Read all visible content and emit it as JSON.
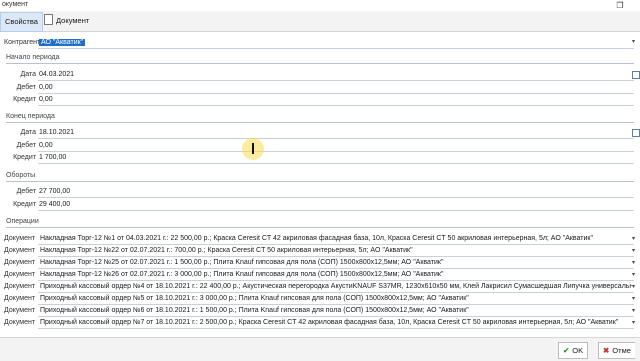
{
  "window": {
    "title": "окумент",
    "restore_glyph": "❐"
  },
  "tabs": [
    {
      "label": "Свойства"
    },
    {
      "label": "Документ"
    }
  ],
  "counterparty": {
    "label": "Контрагент",
    "value": "АО \"Акватик\""
  },
  "period_start": {
    "title": "Начало периода",
    "date_label": "Дата",
    "date": "04.03.2021",
    "debit_label": "Дебет",
    "debit": "0,00",
    "credit_label": "Кредит",
    "credit": "0,00"
  },
  "period_end": {
    "title": "Конец периода",
    "date_label": "Дата",
    "date": "18.10.2021",
    "debit_label": "Дебет",
    "debit": "0,00",
    "credit_label": "Кредит",
    "credit": "1 700,00"
  },
  "turnover": {
    "title": "Обороты",
    "debit_label": "Дебет",
    "debit": "27 700,00",
    "credit_label": "Кредит",
    "credit": "29 400,00"
  },
  "operations": {
    "title": "Операции",
    "row_label": "Документ",
    "rows": [
      "Накладная Торг-12 №1 от 04.03.2021 г.: 22 500,00 р.; Краска Ceresit CT 42 акриловая фасадная база, 10л, Краска Ceresit CT 50 акриловая интерьерная, 5л; АО \"Акватик\"",
      "Накладная Торг-12 №22 от 02.07.2021 г.: 700,00 р.; Краска Ceresit CT 50 акриловая интерьерная, 5л; АО \"Акватик\"",
      "Накладная Торг-12 №25 от 02.07.2021 г.: 1 500,00 р.; Плита Knauf гипсовая для пола (СОП) 1500х800х12,5мм; АО \"Акватик\"",
      "Накладная Торг-12 №26 от 02.07.2021 г.: 3 000,00 р.; Плита Knauf гипсовая для пола (СОП) 1500х800х12,5мм; АО \"Акватик\"",
      "Приходный кассовый ордер №4 от 18.10.2021 г.: 22 400,00 р.; Акустическая перегородка АкустиKNAUF S37MR, 1230х610х50 мм, Клей Лакрисил Сумасшедшая Липучка универсальный",
      "Приходный кассовый ордер №5 от 18.10.2021 г.: 3 000,00 р.; Плита Knauf гипсовая для пола (СОП) 1500х800х12,5мм; АО \"Акватик\"",
      "Приходный кассовый ордер №6 от 18.10.2021 г.: 1 500,00 р.; Плита Knauf гипсовая для пола (СОП) 1500х800х12,5мм; АО \"Акватик\"",
      "Приходный кассовый ордер №7 от 18.10.2021 г.: 2 500,00 р.; Краска Ceresit CT 42 акриловая фасадная база, 10л, Краска Ceresit CT 50 акриловая интерьерная, 5л; АО \"Акватик\""
    ]
  },
  "buttons": {
    "ok": "OK",
    "cancel": "Отме"
  }
}
